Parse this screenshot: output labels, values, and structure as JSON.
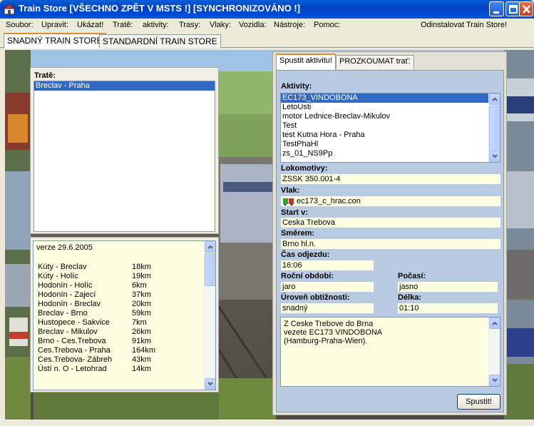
{
  "window": {
    "title": "Train Store [VŠECHNO ZPĚT V MSTS !] [SYNCHRONIZOVÁNO !]"
  },
  "menu": {
    "items": [
      "Soubor:",
      "Upravit:",
      "Ukázat!",
      "Tratě:",
      "aktivity:",
      "Trasy:",
      "Vlaky:",
      "Vozidla:",
      "Nástroje:",
      "Pomoc:"
    ],
    "uninstall": "Odinstalovat Train Store!"
  },
  "main_tabs": [
    "SNADNÝ TRAIN STORE",
    "STANDARDNÍ TRAIN STORE"
  ],
  "left": {
    "routes_label": "Tratě:",
    "routes": [
      "Breclav - Praha"
    ],
    "info_version": "verze 29.6.2005",
    "distances": [
      {
        "name": "Kúty - Breclav",
        "km": "18km"
      },
      {
        "name": "Kúty - Holíc",
        "km": "19km"
      },
      {
        "name": "Hodonín - Holíc",
        "km": "6km"
      },
      {
        "name": "Hodonín - Zajecí",
        "km": "37km"
      },
      {
        "name": "Hodonín - Breclav",
        "km": "20km"
      },
      {
        "name": "Breclav - Brno",
        "km": "59km"
      },
      {
        "name": "Hustopece - Sakvice",
        "km": "7km"
      },
      {
        "name": "Breclav - Mikulov",
        "km": "26km"
      },
      {
        "name": "Brno - Ces.Trebova",
        "km": "91km"
      },
      {
        "name": "Ces.Trebova - Praha",
        "km": "164km"
      },
      {
        "name": "Ces.Trebova- Zábreh",
        "km": "43km"
      },
      {
        "name": "Ústí n. O - Letohrad",
        "km": "14km"
      }
    ]
  },
  "right": {
    "tabs": [
      "Spustit aktivitu!",
      "PROZKOUMAT trať:"
    ],
    "activities_label": "Aktivity:",
    "activities": [
      "EC173_VINDOBONA",
      "LetoUsti",
      "motor Lednice-Breclav-Mikulov",
      "Test",
      "test Kutna Hora - Praha",
      "TestPhaHl",
      "zs_01_NS9Pp"
    ],
    "loco_label": "Lokomotivy:",
    "loco_value": "ZSSK 350.001-4",
    "train_label": "Vlak:",
    "train_value": "ec173_c_hrac.con",
    "start_label": "Start v:",
    "start_value": "Ceska Trebova",
    "direction_label": "Směrem:",
    "direction_value": "Brno hl.n.",
    "time_label": "Čas odjezdu:",
    "time_value": "16:06",
    "season_label": "Roční období:",
    "season_value": "jaro",
    "weather_label": "Počasí:",
    "weather_value": "jasno",
    "difficulty_label": "Úroveň obtížnosti:",
    "difficulty_value": "snadný",
    "duration_label": "Délka:",
    "duration_value": "01:10",
    "description": "Z Ceske Trebove do Brna\nvezete EC173 VINDOBONA\n(Hamburg-Praha-Wien).",
    "start_button": "Spustit!"
  },
  "colors": {
    "titlebar": "#0042c4",
    "selection": "#316ac5",
    "field_bg": "#ffffe1",
    "right_panel_bg": "#b9cbe3"
  }
}
